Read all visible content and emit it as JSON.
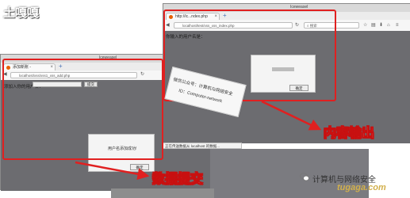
{
  "site_logo": "土嘎嘎",
  "back_window": {
    "title": "Iceweasel",
    "tab_title": "添加新账 -",
    "url": "localhost/xss/xss1_xss_add.php",
    "form_label": "添加入你的用户名：",
    "submit_label": "提交",
    "dialog": {
      "message": "用户名添加成功!",
      "ok_label": "确定"
    }
  },
  "front_window": {
    "window_title": "Iceweasel",
    "tab_title": "http://ic...ndex.php",
    "url": "localhost/test/xss_xss_index.php",
    "search_placeholder": "搜索",
    "content_label": "你输入的用户名是：",
    "dialog": {
      "ok_label": "确定"
    }
  },
  "statusbar_text": "正在传送数据从 localhost 的数据...",
  "stamp": {
    "line1": "微信公众号：计算机与网络安全",
    "line2": "ID：Computer-network"
  },
  "annotations": {
    "output_label": "内容输出",
    "submit_label": "数据提交"
  },
  "wechat_text": "计算机与网络安全",
  "watermark": "tugaga.com",
  "colors": {
    "annotation_red": "#e02020",
    "watermark_gold": "#d2b04c"
  }
}
